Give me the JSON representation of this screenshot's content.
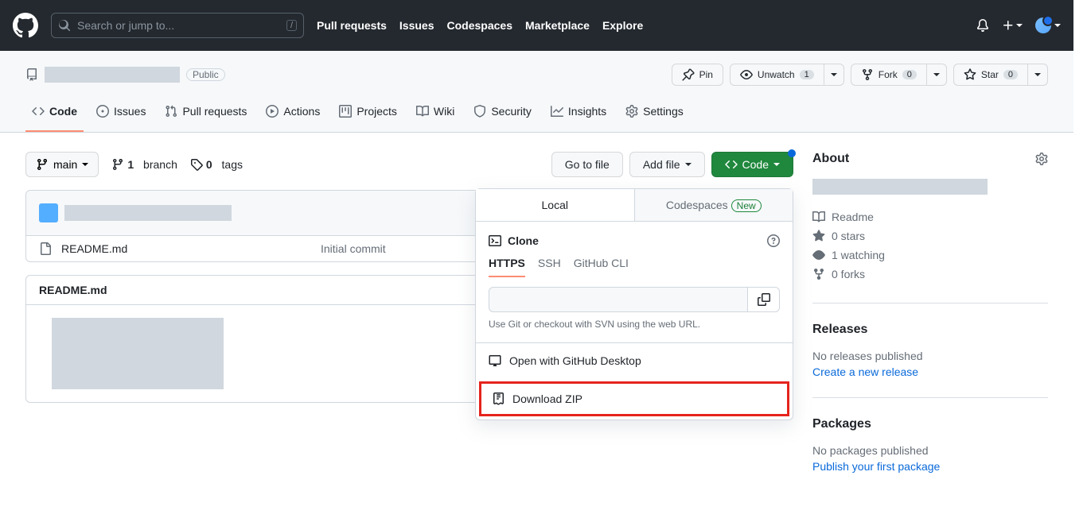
{
  "header": {
    "search_placeholder": "Search or jump to...",
    "nav": [
      "Pull requests",
      "Issues",
      "Codespaces",
      "Marketplace",
      "Explore"
    ]
  },
  "repo": {
    "visibility": "Public",
    "pin": "Pin",
    "unwatch": "Unwatch",
    "unwatch_count": "1",
    "fork": "Fork",
    "fork_count": "0",
    "star": "Star",
    "star_count": "0"
  },
  "tabs": {
    "code": "Code",
    "issues": "Issues",
    "pulls": "Pull requests",
    "actions": "Actions",
    "projects": "Projects",
    "wiki": "Wiki",
    "security": "Security",
    "insights": "Insights",
    "settings": "Settings"
  },
  "toolbar": {
    "branch": "main",
    "branches_count": "1",
    "branches_label": "branch",
    "tags_count": "0",
    "tags_label": "tags",
    "go_to_file": "Go to file",
    "add_file": "Add file",
    "code": "Code"
  },
  "files": {
    "readme": "README.md",
    "commit_msg": "Initial commit"
  },
  "readme": {
    "filename": "README.md"
  },
  "dropdown": {
    "local": "Local",
    "codespaces": "Codespaces",
    "new": "New",
    "clone": "Clone",
    "https": "HTTPS",
    "ssh": "SSH",
    "cli": "GitHub CLI",
    "hint": "Use Git or checkout with SVN using the web URL.",
    "open_desktop": "Open with GitHub Desktop",
    "download_zip": "Download ZIP"
  },
  "sidebar": {
    "about": "About",
    "readme": "Readme",
    "stars": "0 stars",
    "watching": "1 watching",
    "forks": "0 forks",
    "releases": "Releases",
    "no_releases": "No releases published",
    "create_release": "Create a new release",
    "packages": "Packages",
    "no_packages": "No packages published",
    "publish_package": "Publish your first package"
  }
}
